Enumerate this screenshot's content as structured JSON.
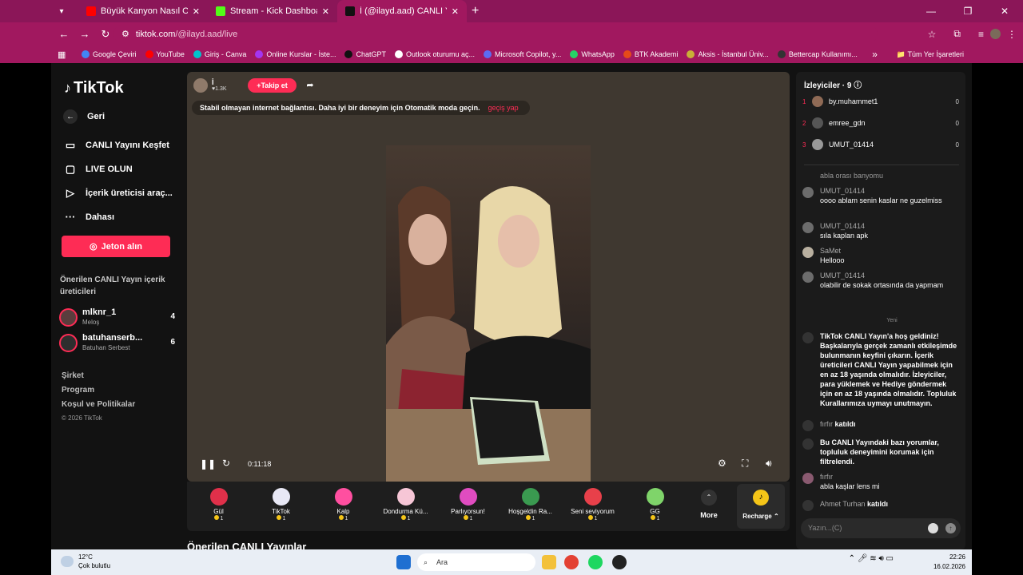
{
  "browser": {
    "tabs": [
      {
        "title": "Büyük Kanyon Nasıl Oluştu? - Y",
        "color": "#ff0000"
      },
      {
        "title": "Stream - Kick Dashboard",
        "color": "#53fc18"
      },
      {
        "title": "İ (@ilayd.aad) CANLI Yayını",
        "color": "#111111"
      }
    ],
    "tab_menu_icon": "▾",
    "tab_close": "✕",
    "new_tab": "+",
    "window_controls": [
      "—",
      "❐",
      "✕"
    ],
    "url_host": "tiktok.com",
    "url_path": "/@ilayd.aad/live",
    "bookmarks": [
      {
        "label": "Google Çeviri",
        "color": "#4285f4"
      },
      {
        "label": "YouTube",
        "color": "#ff0000"
      },
      {
        "label": "Giriş - Canva",
        "color": "#00c4cc"
      },
      {
        "label": "Online Kurslar - İste...",
        "color": "#a435f0"
      },
      {
        "label": "ChatGPT",
        "color": "#111111"
      },
      {
        "label": "Outlook oturumu aç...",
        "color": "#ffffff"
      },
      {
        "label": "Microsoft Copilot, y...",
        "color": "#5c6bf2"
      },
      {
        "label": "WhatsApp",
        "color": "#25d366"
      },
      {
        "label": "BTK Akademi",
        "color": "#e64a19"
      },
      {
        "label": "Aksis - İstanbul Üniv...",
        "color": "#c9b037"
      },
      {
        "label": "Bettercap Kullanımı...",
        "color": "#333333"
      }
    ],
    "bookmarks_more": "»",
    "all_bookmarks": "Tüm Yer İşaretleri"
  },
  "sidebar": {
    "logo": "TikTok",
    "back": "Geri",
    "items": [
      {
        "label": "CANLI Yayını Keşfet",
        "icon": "📺"
      },
      {
        "label": "LIVE OLUN",
        "icon": "🎥"
      },
      {
        "label": "İçerik üreticisi araç...",
        "icon": "▶"
      },
      {
        "label": "Dahası",
        "icon": "···"
      }
    ],
    "coin_button": "Jeton alın",
    "suggested_title": "Önerilen CANLI Yayın içerik üreticileri",
    "creators": [
      {
        "name": "mlknr_1",
        "sub": "Meloş",
        "count": "4"
      },
      {
        "name": "batuhanserb...",
        "sub": "Batuhan Serbest",
        "count": "6"
      }
    ],
    "footer": [
      "Şirket",
      "Program",
      "Koşul ve Politikalar"
    ],
    "copyright": "© 2026 TikTok"
  },
  "player": {
    "host_name": "İ",
    "host_likes": "1.3K",
    "follow": "Takip et",
    "warning": "Stabil olmayan internet bağlantısı. Daha iyi bir deneyim için Otomatik moda geçin.",
    "warning_link": "geçiş yap",
    "time": "0:11:18"
  },
  "gifts": [
    {
      "name": "Gül",
      "cost": "1",
      "color": "#e0304a"
    },
    {
      "name": "TikTok",
      "cost": "1",
      "color": "#e8e8f5"
    },
    {
      "name": "Kalp",
      "cost": "1",
      "color": "#ff4fa0"
    },
    {
      "name": "Dondurma Kü...",
      "cost": "1",
      "color": "#f6c6d6"
    },
    {
      "name": "Parlıyorsun!",
      "cost": "1",
      "color": "#e04cc0"
    },
    {
      "name": "Hoşgeldin Ra...",
      "cost": "1",
      "color": "#3a9a50"
    },
    {
      "name": "Seni seviyorum",
      "cost": "1",
      "color": "#e8404a"
    },
    {
      "name": "GG",
      "cost": "1",
      "color": "#7fd46a"
    }
  ],
  "gifts_more": "More",
  "recharge": "Recharge",
  "bottom_title": "Önerilen CANLI Yayınlar",
  "chat": {
    "viewers_title": "İzleyiciler · 9",
    "viewers": [
      {
        "rank": "1",
        "name": "by.muhammet1",
        "score": "0"
      },
      {
        "rank": "2",
        "name": "emree_gdn",
        "score": "0"
      },
      {
        "rank": "3",
        "name": "UMUT_01414",
        "score": "0"
      }
    ],
    "partial": "abla orası banyomu",
    "messages": [
      {
        "user": "UMUT_01414",
        "text": "oooo ablam senin kaslar ne guzelmiss"
      },
      {
        "user": "UMUT_01414",
        "text": "sıla kaplan apk"
      },
      {
        "user": "SaMet",
        "text": "Hellooo"
      },
      {
        "user": "UMUT_01414",
        "text": "olabilir de sokak ortasında da yapmam"
      }
    ],
    "new_separator": "Yeni",
    "system1": "TikTok CANLI Yayın'a hoş geldiniz! Başkalarıyla gerçek zamanlı etkileşimde bulunmanın keyfini çıkarın. İçerik üreticileri CANLI Yayın yapabilmek için en az 18 yaşında olmalıdır. İzleyiciler, para yüklemek ve Hediye göndermek için en az 18 yaşında olmalıdır. Topluluk Kurallarımıza uymayı unutmayın.",
    "join1_user": "fırfır",
    "join1_text": "katıldı",
    "system2": "Bu CANLI Yayındaki bazı yorumlar, topluluk deneyimini korumak için filtrelendi.",
    "msg_last_user": "fırfır",
    "msg_last_text": "abla kaşlar lens mi",
    "join2_user": "Ahmet Turhan",
    "join2_text": "katıldı",
    "input_placeholder": "Yazın...(C)"
  },
  "taskbar": {
    "temp": "12°C",
    "weather": "Çok bulutlu",
    "search": "Ara",
    "time": "22:26",
    "date": "16.02.2026"
  }
}
